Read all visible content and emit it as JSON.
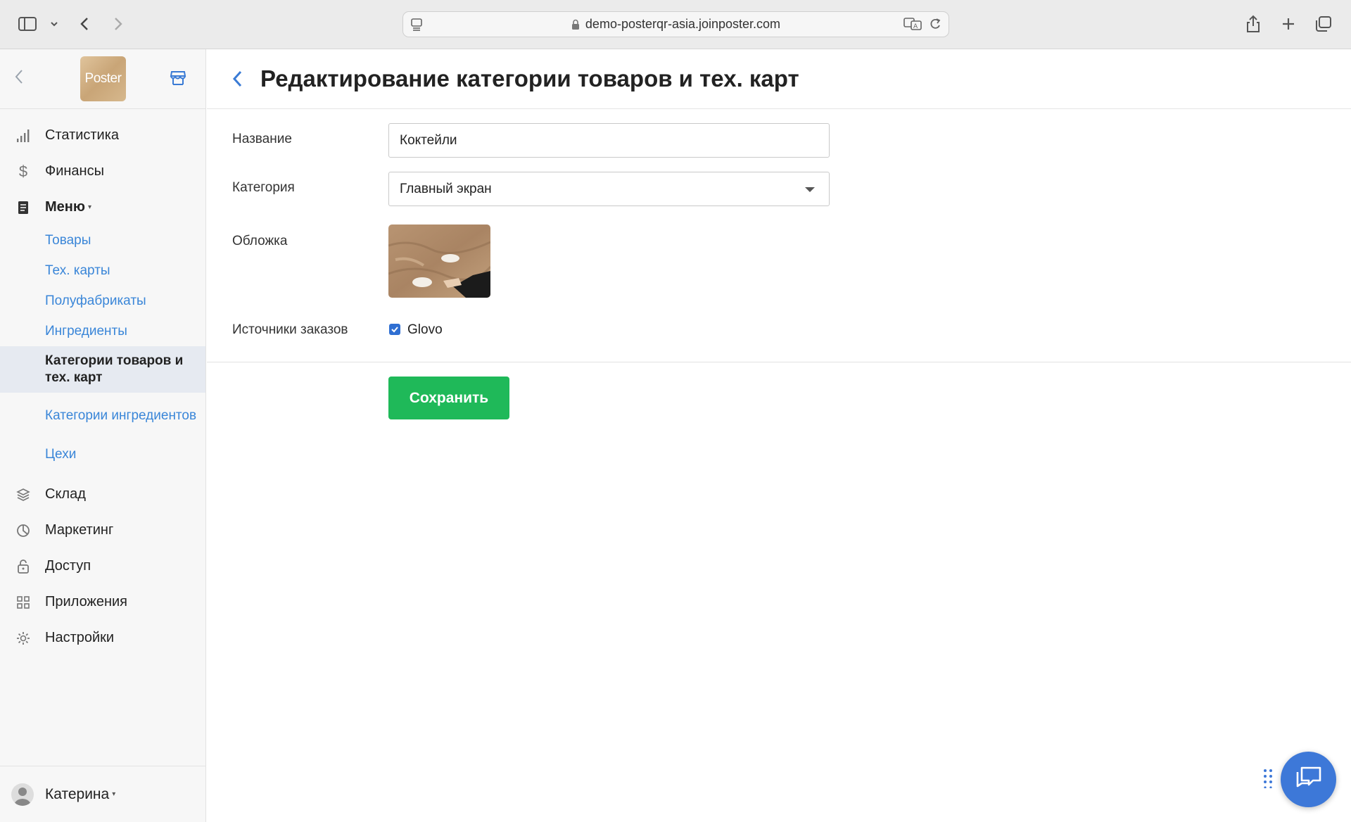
{
  "browser": {
    "url": "demo-posterqr-asia.joinposter.com"
  },
  "sidebar": {
    "logo_text": "Poster",
    "nav": [
      {
        "label": "Статистика",
        "icon": "bar-chart-icon"
      },
      {
        "label": "Финансы",
        "icon": "dollar-icon"
      },
      {
        "label": "Меню",
        "icon": "document-icon",
        "expanded": true
      }
    ],
    "menu_sub": [
      {
        "label": "Товары"
      },
      {
        "label": "Тех. карты"
      },
      {
        "label": "Полуфабрикаты"
      },
      {
        "label": "Ингредиенты"
      },
      {
        "label": "Категории товаров и тех. карт",
        "active": true
      },
      {
        "label": "Категории ингредиентов"
      },
      {
        "label": "Цехи"
      }
    ],
    "nav_bottom": [
      {
        "label": "Склад",
        "icon": "layers-icon"
      },
      {
        "label": "Маркетинг",
        "icon": "pie-chart-icon"
      },
      {
        "label": "Доступ",
        "icon": "lock-icon"
      },
      {
        "label": "Приложения",
        "icon": "grid-icon"
      },
      {
        "label": "Настройки",
        "icon": "gear-icon"
      }
    ],
    "user": "Катерина"
  },
  "page": {
    "title": "Редактирование категории товаров и тех. карт"
  },
  "form": {
    "name_label": "Название",
    "name_value": "Коктейли",
    "category_label": "Категория",
    "category_value": "Главный экран",
    "cover_label": "Обложка",
    "sources_label": "Источники заказов",
    "source_glovo": "Glovo",
    "source_glovo_checked": true,
    "save_label": "Сохранить"
  },
  "colors": {
    "accent": "#3a86d8",
    "save_button": "#1fb959",
    "chat_button": "#3d78d8"
  }
}
